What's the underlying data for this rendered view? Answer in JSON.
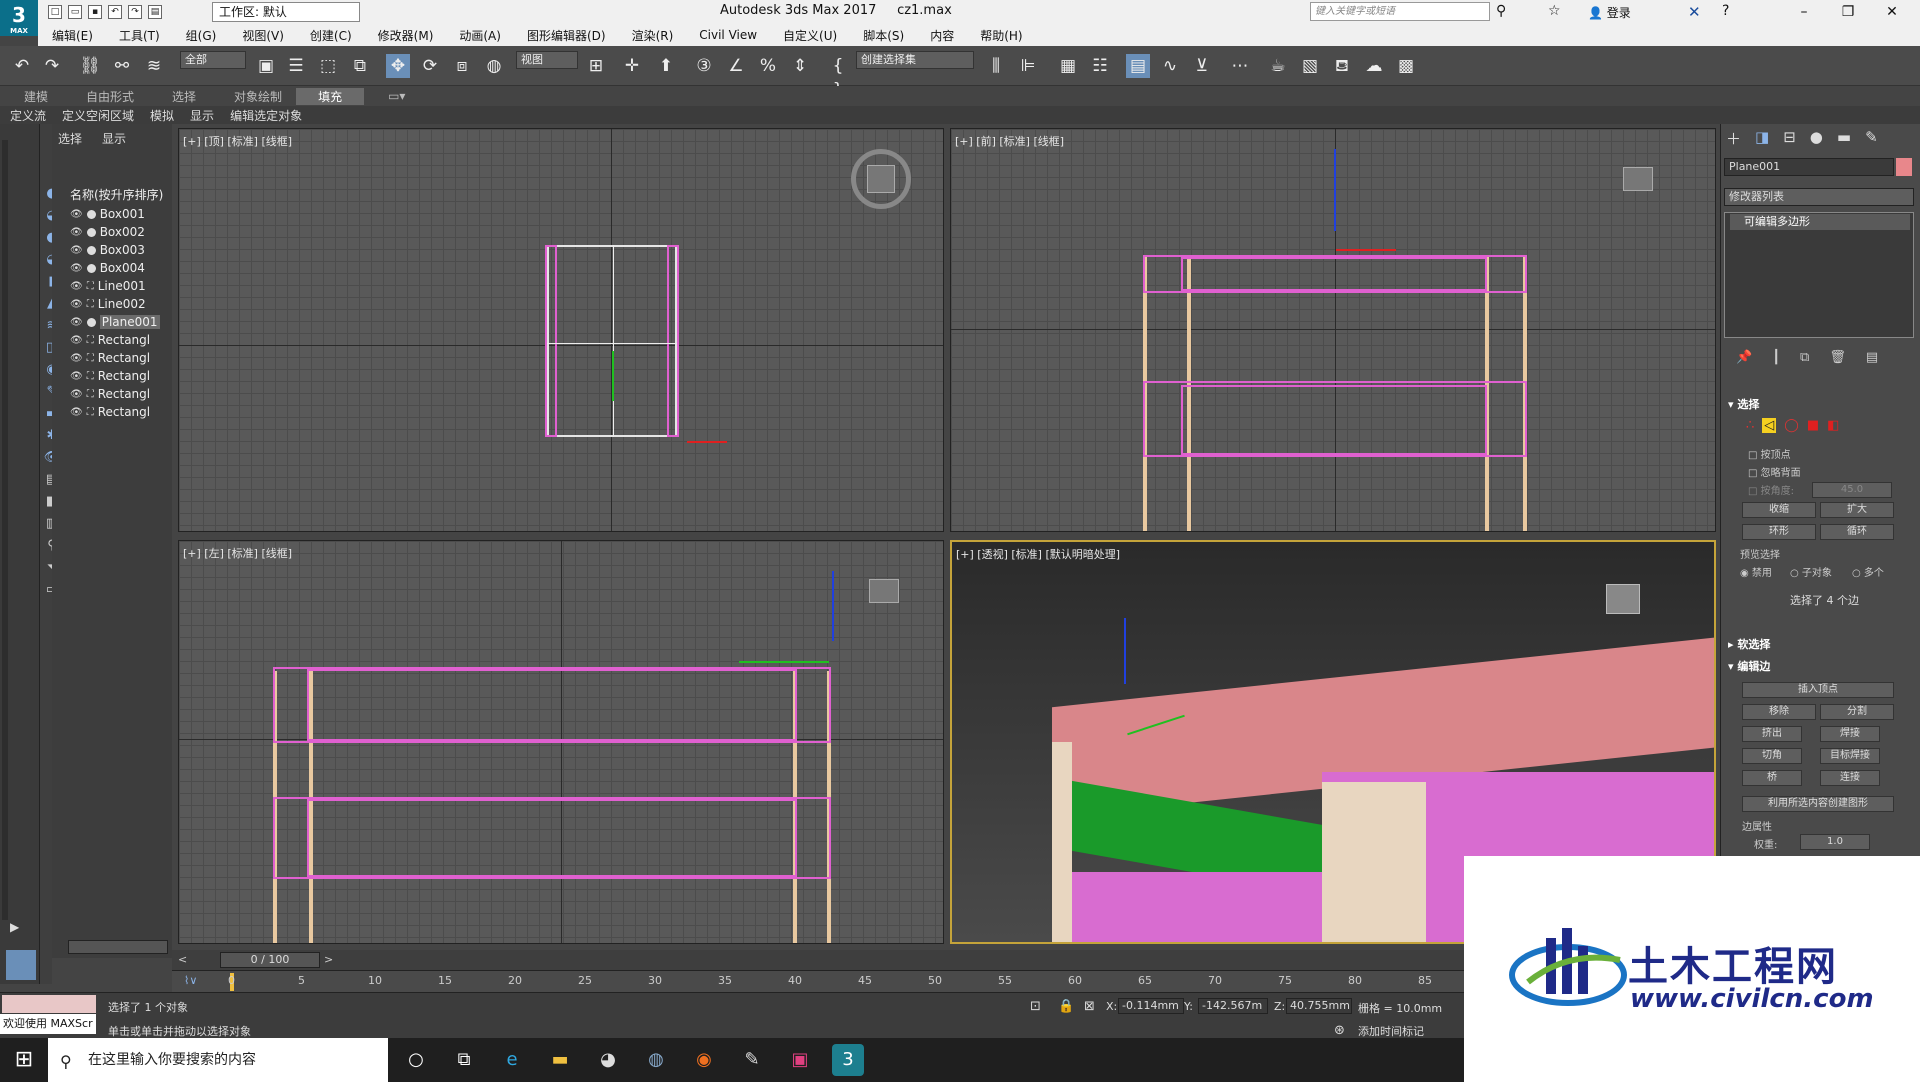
{
  "titlebar": {
    "workspace": "工作区: 默认",
    "app": "Autodesk 3ds Max 2017",
    "file": "cz1.max",
    "search": "键入关键字或短语",
    "login": "登录",
    "logo": "3",
    "logo_sub": "MAX"
  },
  "menu": [
    "编辑(E)",
    "工具(T)",
    "组(G)",
    "视图(V)",
    "创建(C)",
    "修改器(M)",
    "动画(A)",
    "图形编辑器(D)",
    "渲染(R)",
    "Civil View",
    "自定义(U)",
    "脚本(S)",
    "内容",
    "帮助(H)"
  ],
  "toolbar": {
    "filter": "全部",
    "refcoord": "视图",
    "selset": "创建选择集"
  },
  "ribbon_tabs": [
    "建模",
    "自由形式",
    "选择",
    "对象绘制",
    "填充"
  ],
  "ribbon_active": "填充",
  "sub_tabs": [
    "定义流",
    "定义空闲区域",
    "模拟",
    "显示",
    "编辑选定对象"
  ],
  "scene": {
    "tab_select": "选择",
    "tab_display": "显示",
    "column": "名称(按升序排序)",
    "objects": [
      "Box001",
      "Box002",
      "Box003",
      "Box004",
      "Line001",
      "Line002",
      "Plane001",
      "Rectangl",
      "Rectangl",
      "Rectangl",
      "Rectangl",
      "Rectangl"
    ],
    "selected": "Plane001"
  },
  "viewports": {
    "top": "[+] [顶] [标准] [线框]",
    "front": "[+] [前] [标准] [线框]",
    "left": "[+] [左] [标准] [线框]",
    "persp": "[+] [透视] [标准] [默认明暗处理]"
  },
  "cmd": {
    "object_name": "Plane001",
    "object_color": "#e8878b",
    "modifier_list": "修改器列表",
    "stack_item": "可编辑多边形",
    "sel_head": "选择",
    "by_vertex": "按顶点",
    "ignore_back": "忽略背面",
    "angle_label": "按角度:",
    "angle": "45.0",
    "shrink": "收缩",
    "grow": "扩大",
    "ring": "环形",
    "loop": "循环",
    "preview": "预览选择",
    "off": "禁用",
    "subobj": "子对象",
    "multi": "多个",
    "sel_count": "选择了 4 个边",
    "soft_sel": "软选择",
    "edit_edges": "编辑边",
    "insert_vertex": "插入顶点",
    "remove": "移除",
    "split": "分割",
    "extrude": "挤出",
    "weld": "焊接",
    "chamfer": "切角",
    "target_weld": "目标焊接",
    "bridge": "桥",
    "connect": "连接",
    "create_shape": "利用所选内容创建图形",
    "edge_props": "边属性",
    "weight_label": "权重:",
    "weight": "1.0"
  },
  "timeline": {
    "slider": "0 / 100",
    "ticks": [
      "0",
      "5",
      "10",
      "15",
      "20",
      "25",
      "30",
      "35",
      "40",
      "45",
      "50",
      "55",
      "60",
      "65",
      "70",
      "75",
      "80",
      "85"
    ]
  },
  "status": {
    "selected": "选择了 1 个对象",
    "hint": "单击或单击并拖动以选择对象",
    "welcome": "欢迎使用 MAXScr",
    "x_label": "X:",
    "x": "-0.114mm",
    "y_label": "Y:",
    "y": "-142.567m",
    "z_label": "Z:",
    "z": "40.755mm",
    "grid": "栅格 = 10.0mm",
    "add_tag": "添加时间标记"
  },
  "taskbar": {
    "search": "在这里输入你要搜索的内容"
  },
  "watermark": {
    "title": "土木工程网",
    "url": "www.civilcn.com"
  }
}
